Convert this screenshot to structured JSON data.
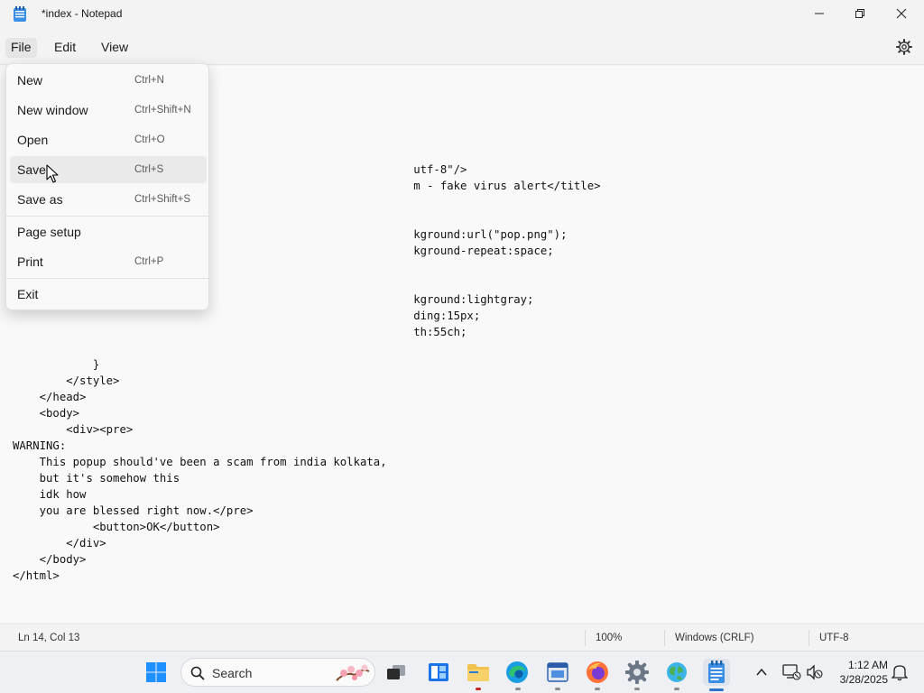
{
  "window": {
    "title": "*index - Notepad"
  },
  "menubar": {
    "file": "File",
    "edit": "Edit",
    "view": "View"
  },
  "file_menu": {
    "items": [
      {
        "label": "New",
        "shortcut": "Ctrl+N"
      },
      {
        "label": "New window",
        "shortcut": "Ctrl+Shift+N"
      },
      {
        "label": "Open",
        "shortcut": "Ctrl+O"
      },
      {
        "label": "Save",
        "shortcut": "Ctrl+S"
      },
      {
        "label": "Save as",
        "shortcut": "Ctrl+Shift+S"
      },
      {
        "label": "Page setup",
        "shortcut": ""
      },
      {
        "label": "Print",
        "shortcut": "Ctrl+P"
      },
      {
        "label": "Exit",
        "shortcut": ""
      }
    ]
  },
  "editor": {
    "visible_text": "\n\n\t\t\t\t\t\t\t\t\t\t\t\t\t\t\tutf-8\"/>\n\t\t\t\t\t\t\t\t\t\t\t\t\t\t\tm - fake virus alert</title>\n\n\n\t\t\t\t\t\t\t\t\t\t\t\t\t\t\tkground:url(\"pop.png\");\n\t\t\t\t\t\t\t\t\t\t\t\t\t\t\tkground-repeat:space;\n\n\n\t\t\t\t\t\t\t\t\t\t\t\t\t\t\tkground:lightgray;\n\t\t\t\t\t\t\t\t\t\t\t\t\t\t\tding:15px;\n\t\t\t\t\t\t\t\t\t\t\t\t\t\t\tth:55ch;\n\n\t\t\t}\n\t\t</style>\n\t</head>\n\t<body>\n\t\t<div><pre>\nWARNING:\n\tThis popup should've been a scam from india kolkata,\n\tbut it's somehow this\n\tidk how\n\tyou are blessed right now.</pre>\n\t\t\t<button>OK</button>\n\t\t</div>\n\t</body>\n</html>"
  },
  "statusbar": {
    "position": "Ln 14, Col 13",
    "zoom": "100%",
    "line_ending": "Windows (CRLF)",
    "encoding": "UTF-8"
  },
  "taskbar": {
    "search_label": "Search",
    "time": "1:12 AM",
    "date": "3/28/2025"
  },
  "colors": {
    "accent": "#2a73c9",
    "menu_hover": "#eaeaea",
    "background": "#f3f3f3"
  }
}
